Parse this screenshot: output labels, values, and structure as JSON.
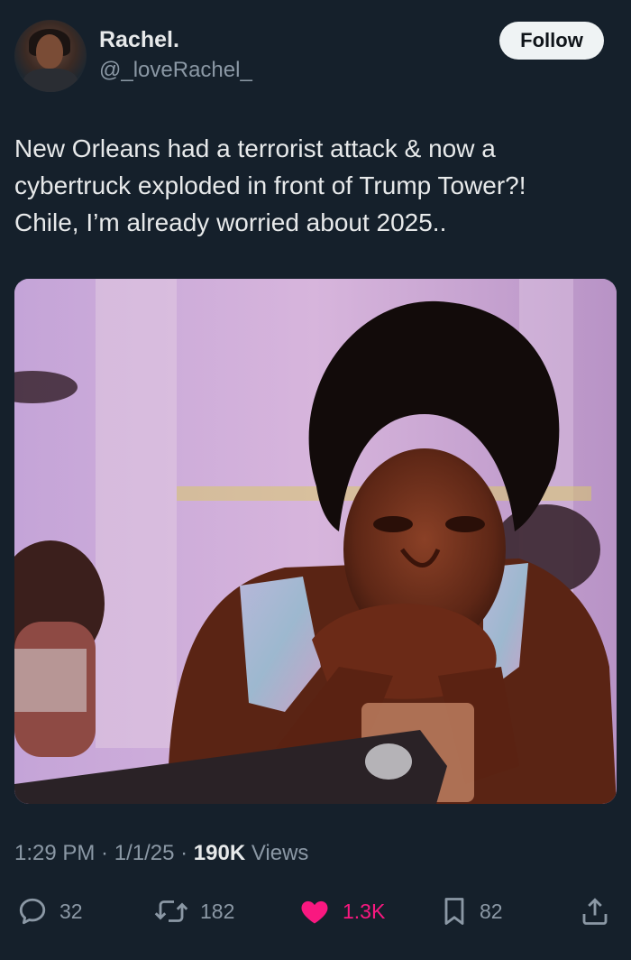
{
  "author": {
    "display_name": "Rachel.",
    "handle": "@_loveRachel_"
  },
  "follow_button": {
    "label": "Follow"
  },
  "tweet": {
    "text": "New Orleans had a terrorist attack & now a\ncybertruck exploded in front of Trump Tower?!\nChile, I’m already worried about 2025.."
  },
  "meta": {
    "time": "1:29 PM",
    "separator": " · ",
    "date": "1/1/25",
    "views_count": "190K",
    "views_label": " Views"
  },
  "actions": {
    "replies": {
      "icon": "reply-icon",
      "count": "32"
    },
    "retweets": {
      "icon": "retweet-icon",
      "count": "182"
    },
    "likes": {
      "icon": "heart-icon",
      "count": "1.3K",
      "liked": true,
      "color": "#f91880"
    },
    "bookmarks": {
      "icon": "bookmark-icon",
      "count": "82"
    },
    "share": {
      "icon": "share-icon"
    }
  },
  "colors": {
    "background": "#15202b",
    "text": "#e7e9ea",
    "secondary": "#8b98a5",
    "like_pink": "#f91880"
  }
}
